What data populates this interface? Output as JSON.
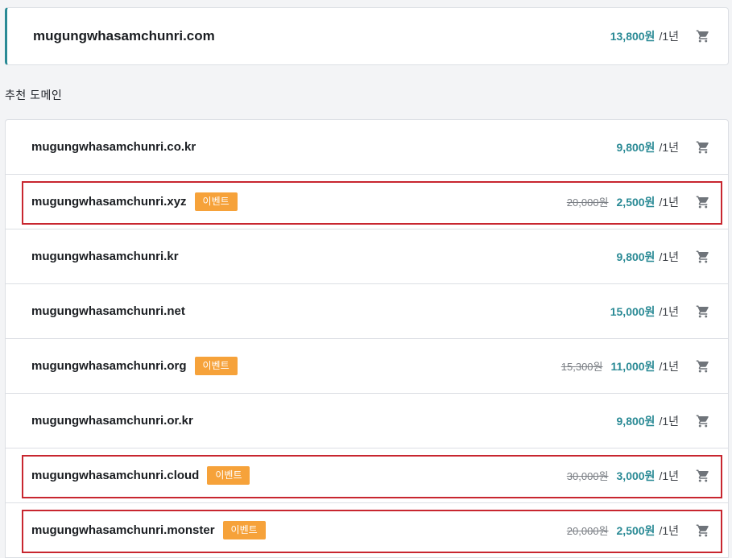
{
  "primary": {
    "domain": "mugungwhasamchunri.com",
    "price": "13,800원",
    "period": "/1년"
  },
  "section_label": "추천 도메인",
  "recommended": [
    {
      "domain": "mugungwhasamchunri.co.kr",
      "badge": "",
      "original_price": "",
      "price": "9,800원",
      "period": "/1년",
      "highlighted": false
    },
    {
      "domain": "mugungwhasamchunri.xyz",
      "badge": "이벤트",
      "original_price": "20,000원",
      "price": "2,500원",
      "period": "/1년",
      "highlighted": true
    },
    {
      "domain": "mugungwhasamchunri.kr",
      "badge": "",
      "original_price": "",
      "price": "9,800원",
      "period": "/1년",
      "highlighted": false
    },
    {
      "domain": "mugungwhasamchunri.net",
      "badge": "",
      "original_price": "",
      "price": "15,000원",
      "period": "/1년",
      "highlighted": false
    },
    {
      "domain": "mugungwhasamchunri.org",
      "badge": "이벤트",
      "original_price": "15,300원",
      "price": "11,000원",
      "period": "/1년",
      "highlighted": false
    },
    {
      "domain": "mugungwhasamchunri.or.kr",
      "badge": "",
      "original_price": "",
      "price": "9,800원",
      "period": "/1년",
      "highlighted": false
    },
    {
      "domain": "mugungwhasamchunri.cloud",
      "badge": "이벤트",
      "original_price": "30,000원",
      "price": "3,000원",
      "period": "/1년",
      "highlighted": true
    },
    {
      "domain": "mugungwhasamchunri.monster",
      "badge": "이벤트",
      "original_price": "20,000원",
      "price": "2,500원",
      "period": "/1년",
      "highlighted": true
    }
  ],
  "icons": {
    "cart": "shopping-cart-icon"
  },
  "colors": {
    "accent": "#2a8a95",
    "badge": "#f6a23a",
    "highlight_border": "#c8262f"
  }
}
